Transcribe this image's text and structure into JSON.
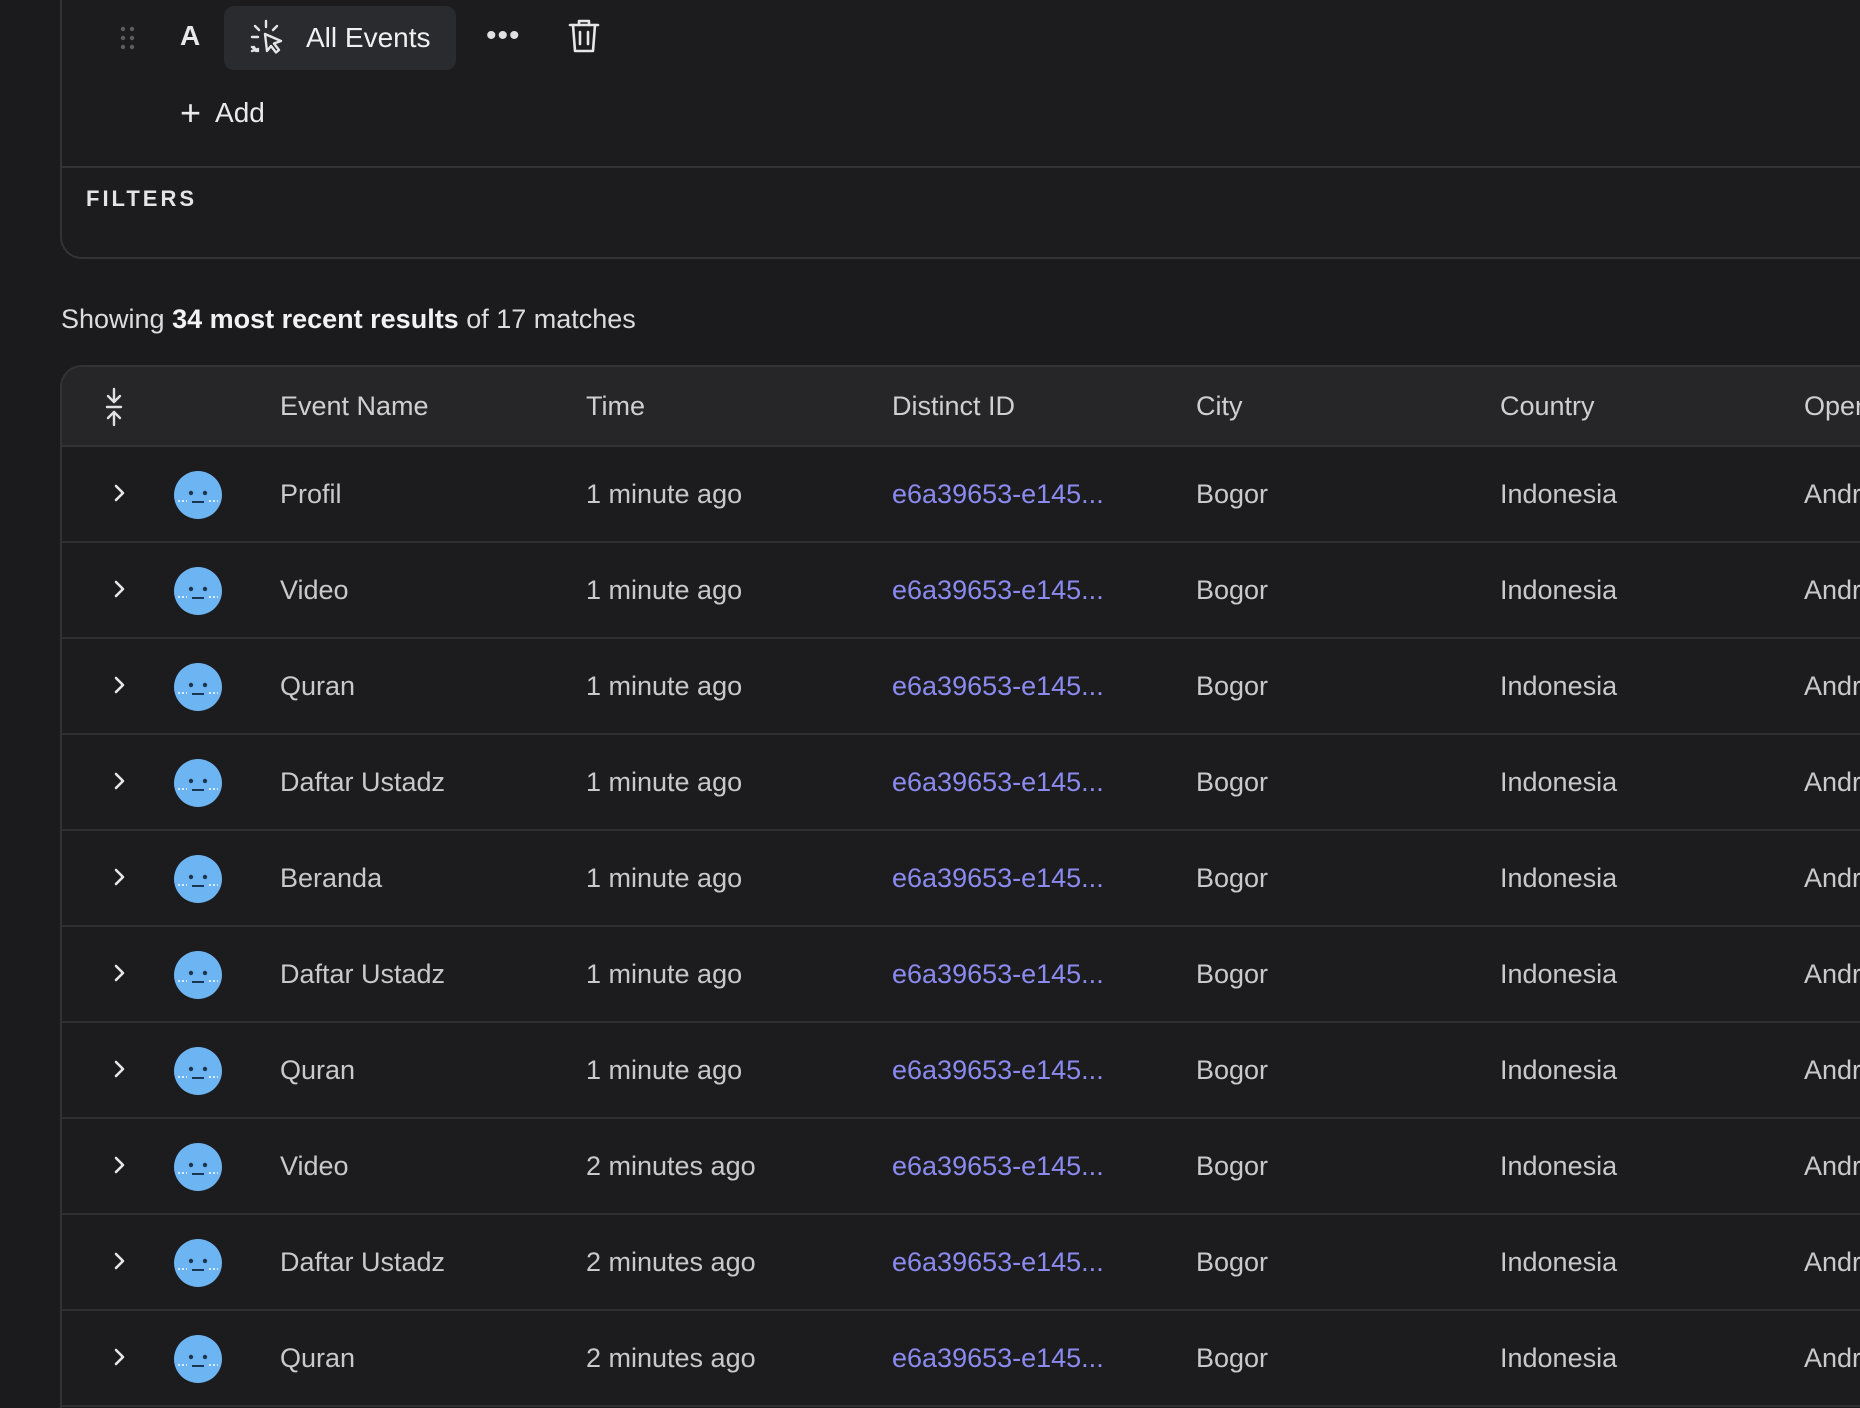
{
  "query": {
    "row_letter": "A",
    "event_chip_label": "All Events",
    "more_label": "•••",
    "add_label": "Add",
    "filters_label": "FILTERS"
  },
  "summary": {
    "prefix": "Showing ",
    "bold": "34 most recent results",
    "suffix": " of 17 matches"
  },
  "table": {
    "columns": {
      "event_name": "Event Name",
      "time": "Time",
      "distinct_id": "Distinct ID",
      "city": "City",
      "country": "Country",
      "os": "Oper"
    },
    "rows": [
      {
        "event": "Profil",
        "time": "1 minute ago",
        "id": "e6a39653-e145...",
        "city": "Bogor",
        "country": "Indonesia",
        "os": "Andr"
      },
      {
        "event": "Video",
        "time": "1 minute ago",
        "id": "e6a39653-e145...",
        "city": "Bogor",
        "country": "Indonesia",
        "os": "Andr"
      },
      {
        "event": "Quran",
        "time": "1 minute ago",
        "id": "e6a39653-e145...",
        "city": "Bogor",
        "country": "Indonesia",
        "os": "Andr"
      },
      {
        "event": "Daftar Ustadz",
        "time": "1 minute ago",
        "id": "e6a39653-e145...",
        "city": "Bogor",
        "country": "Indonesia",
        "os": "Andr"
      },
      {
        "event": "Beranda",
        "time": "1 minute ago",
        "id": "e6a39653-e145...",
        "city": "Bogor",
        "country": "Indonesia",
        "os": "Andr"
      },
      {
        "event": "Daftar Ustadz",
        "time": "1 minute ago",
        "id": "e6a39653-e145...",
        "city": "Bogor",
        "country": "Indonesia",
        "os": "Andr"
      },
      {
        "event": "Quran",
        "time": "1 minute ago",
        "id": "e6a39653-e145...",
        "city": "Bogor",
        "country": "Indonesia",
        "os": "Andr"
      },
      {
        "event": "Video",
        "time": "2 minutes ago",
        "id": "e6a39653-e145...",
        "city": "Bogor",
        "country": "Indonesia",
        "os": "Andr"
      },
      {
        "event": "Daftar Ustadz",
        "time": "2 minutes ago",
        "id": "e6a39653-e145...",
        "city": "Bogor",
        "country": "Indonesia",
        "os": "Andr"
      },
      {
        "event": "Quran",
        "time": "2 minutes ago",
        "id": "e6a39653-e145...",
        "city": "Bogor",
        "country": "Indonesia",
        "os": "Andr"
      }
    ]
  },
  "colors": {
    "background": "#1b1b1d",
    "header": "#262629",
    "link": "#8a8af0",
    "avatar": "#6db4f2"
  },
  "icons": {
    "drag": "drag-handle-icon",
    "event": "cursor-click-icon",
    "more": "more-horizontal-icon",
    "delete": "trash-icon",
    "add": "plus-icon",
    "sort": "collapse-vertical-icon",
    "expand": "chevron-right-icon",
    "avatar": "user-face-avatar"
  }
}
